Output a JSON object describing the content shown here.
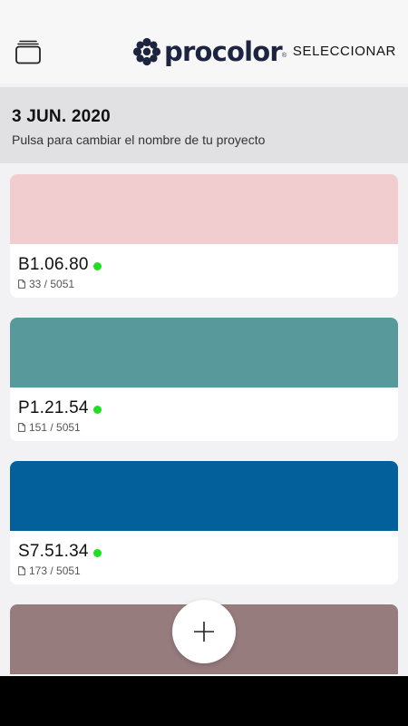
{
  "header": {
    "logo_text": "procolor",
    "logo_mark": "®",
    "select_label": "SELECCIONAR",
    "stack_icon": "stack-icon"
  },
  "project": {
    "date": "3 JUN. 2020",
    "subtitle": "Pulsa para cambiar el nombre de tu proyecto"
  },
  "colors": [
    {
      "code": "B1.06.80",
      "page": "33 / 5051",
      "swatch": "#f1cdcf",
      "status": "#1fe01f"
    },
    {
      "code": "P1.21.54",
      "page": "151 / 5051",
      "swatch": "#589a9c",
      "status": "#1fe01f"
    },
    {
      "code": "S7.51.34",
      "page": "173 / 5051",
      "swatch": "#03609a",
      "status": "#1fe01f"
    },
    {
      "code": "",
      "page": "",
      "swatch": "#977c7e",
      "status": ""
    }
  ],
  "fab": {
    "icon": "plus-icon"
  }
}
